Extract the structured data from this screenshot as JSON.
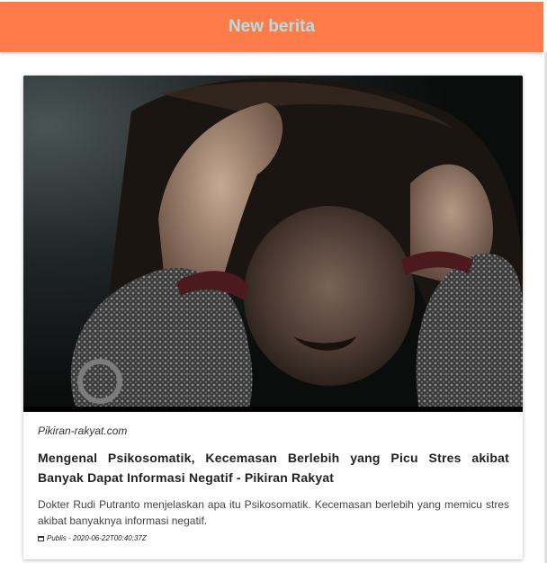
{
  "header": {
    "title": "New berita"
  },
  "article": {
    "source": "Pikiran-rakyat.com",
    "title": "Mengenal Psikosomatik, Kecemasan Berlebih yang Picu Stres akibat Banyak Dapat Informasi Negatif - Pikiran Rakyat",
    "description": "Dokter Rudi Putranto menjelaskan apa itu Psikosomatik. Kecemasan berlebih yang memicu stres akibat banyaknya informasi negatif.",
    "published": "Publis - 2020-06-22T00:40:37Z",
    "icons": {
      "published": "calendar-icon"
    }
  },
  "colors": {
    "header_bg": "#ff7b4a",
    "header_text": "#aee0e3"
  }
}
